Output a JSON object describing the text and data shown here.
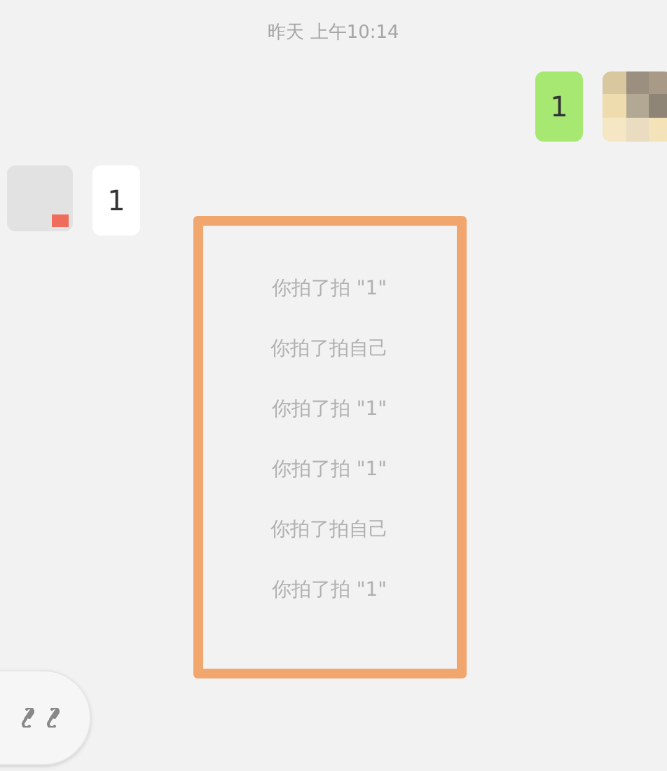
{
  "timestamp": "昨天 上午10:14",
  "messages": [
    {
      "kind": "sent",
      "text": "1"
    },
    {
      "kind": "received",
      "text": "1"
    }
  ],
  "pat_notices": [
    "你拍了拍 \"1\"",
    "你拍了拍自己",
    "你拍了拍 \"1\"",
    "你拍了拍 \"1\"",
    "你拍了拍自己",
    "你拍了拍 \"1\""
  ]
}
